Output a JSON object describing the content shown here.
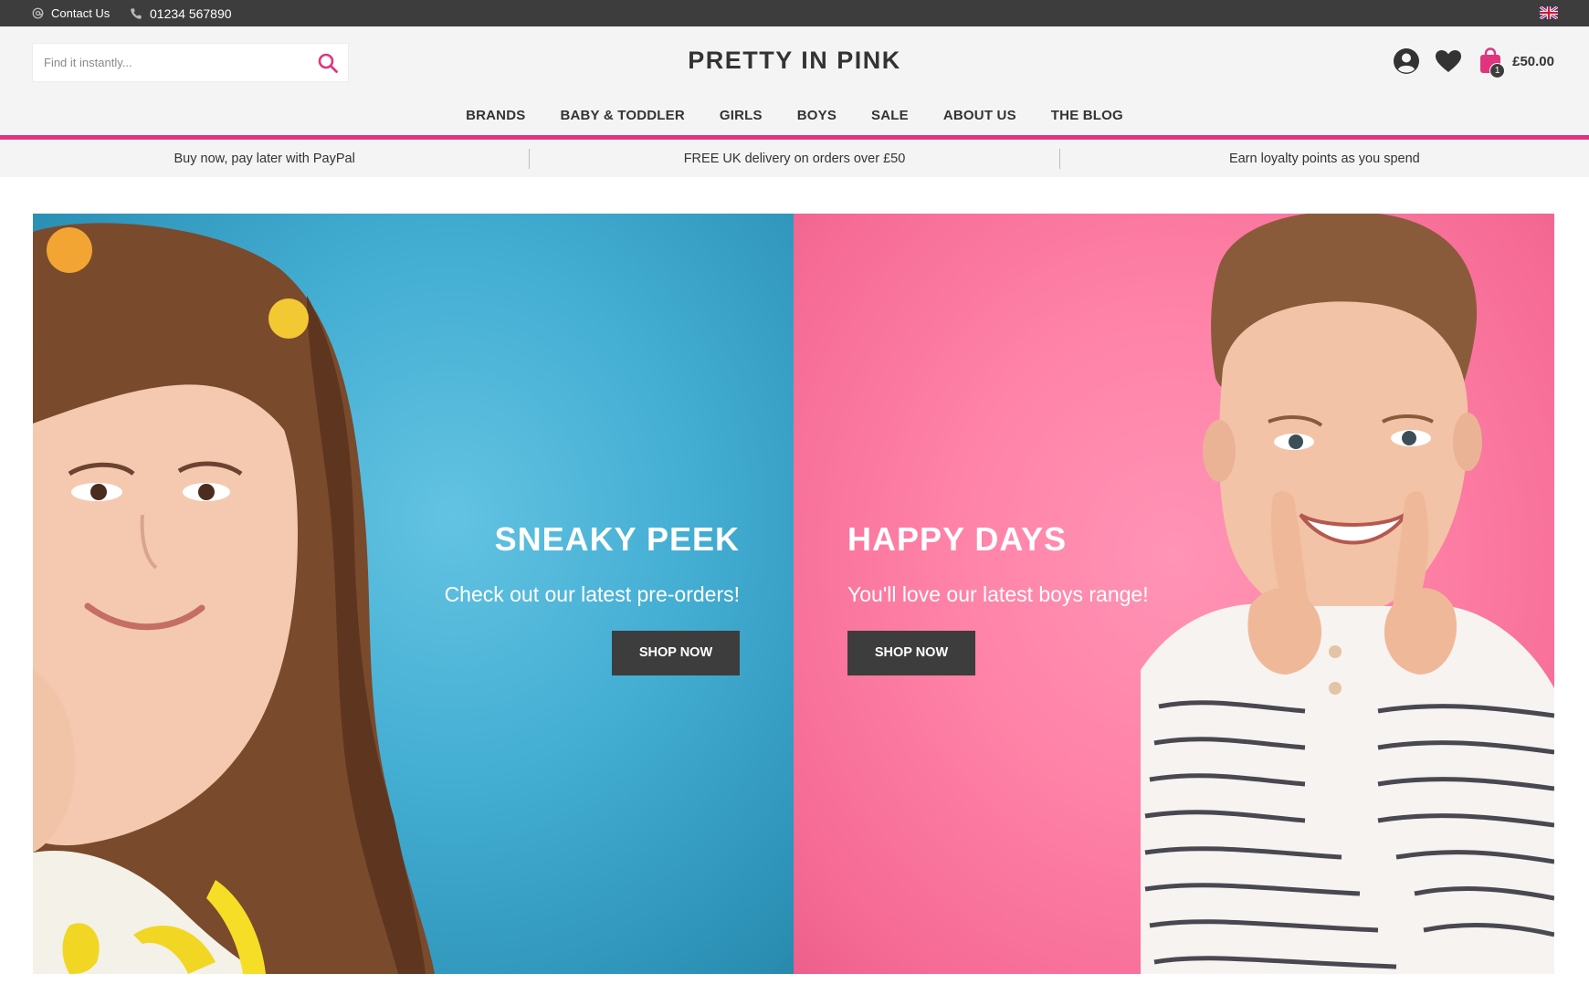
{
  "topbar": {
    "contact_label": "Contact Us",
    "phone": "01234 567890",
    "flag_icon": "uk-flag-icon"
  },
  "header": {
    "search": {
      "placeholder": "Find it instantly..."
    },
    "brand": "PRETTY IN PINK",
    "cart": {
      "count": "1",
      "total": "£50.00"
    },
    "accent_color": "#e0357e"
  },
  "nav": {
    "items": [
      "BRANDS",
      "BABY & TODDLER",
      "GIRLS",
      "BOYS",
      "SALE",
      "ABOUT US",
      "THE BLOG"
    ]
  },
  "usp": {
    "items": [
      "Buy now, pay later with PayPal",
      "FREE UK delivery on orders over £50",
      "Earn loyalty points as you spend"
    ]
  },
  "hero": {
    "panels": [
      {
        "title": "SNEAKY PEEK",
        "subtitle": "Check out our latest pre-orders!",
        "button": "SHOP NOW",
        "background": "#44aed3"
      },
      {
        "title": "HAPPY DAYS",
        "subtitle": "You'll love our latest boys range!",
        "button": "SHOP NOW",
        "background": "#ff83a8"
      }
    ]
  }
}
